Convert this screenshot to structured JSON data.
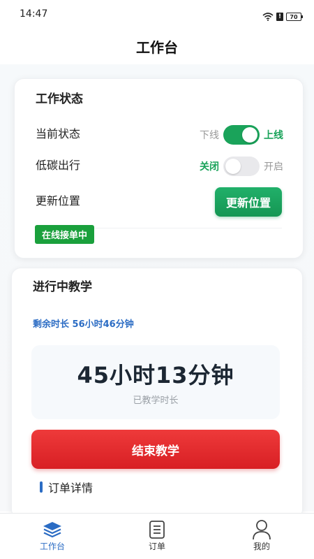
{
  "status_bar": {
    "time": "14:47",
    "battery": "70"
  },
  "header": {
    "title": "工作台"
  },
  "work_status": {
    "title": "工作状态",
    "current_status": {
      "label": "当前状态",
      "off_label": "下线",
      "on_label": "上线",
      "value": "on"
    },
    "low_carbon": {
      "label": "低碳出行",
      "on_label": "关闭",
      "off_label": "开启",
      "value": "off"
    },
    "update_location": {
      "label": "更新位置",
      "button_label": "更新位置"
    },
    "badge": "在线接单中"
  },
  "teaching": {
    "title": "进行中教学",
    "remaining": "剩余时长  56小时46分钟",
    "elapsed_value": "45小时13分钟",
    "elapsed_caption": "已教学时长",
    "end_button": "结束教学",
    "order_detail": "订单详情"
  },
  "tabbar": {
    "items": [
      {
        "label": "工作台",
        "icon": "layers-icon",
        "active": true
      },
      {
        "label": "订单",
        "icon": "document-list-icon",
        "active": false
      },
      {
        "label": "我的",
        "icon": "person-icon",
        "active": false
      }
    ]
  },
  "colors": {
    "accent_green": "#1aa35a",
    "accent_blue": "#2b6cc4",
    "danger_red": "#e02a2e"
  }
}
